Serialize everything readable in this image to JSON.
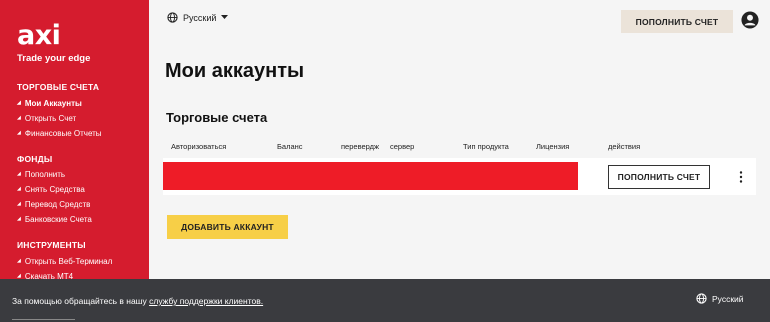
{
  "sidebar": {
    "logo": "axi",
    "tagline": "Trade your edge",
    "sections": [
      {
        "title": "ТОРГОВЫЕ СЧЕТА",
        "items": [
          "Мои Аккаунты",
          "Открыть Счет",
          "Финансовые Отчеты"
        ]
      },
      {
        "title": "ФОНДЫ",
        "items": [
          "Пополнить",
          "Снять Средства",
          "Перевод Средств",
          "Банковские Счета"
        ]
      },
      {
        "title": "ИНСТРУМЕНТЫ",
        "items": [
          "Открыть Веб-Терминал",
          "Скачать МТ4"
        ]
      }
    ]
  },
  "header": {
    "language": "Русский",
    "fund_button": "ПОПОЛНИТЬ СЧЕТ"
  },
  "main": {
    "title": "Мои аккаунты",
    "section_title": "Торговые счета",
    "columns": [
      "Авторизоваться",
      "Баланс",
      "перевердж",
      "сервер",
      "Тип продукта",
      "Лицензия",
      "действия"
    ],
    "row_fund_button": "ПОПОЛНИТЬ СЧЕТ",
    "add_account_button": "ДОБАВИТЬ АККАУНТ"
  },
  "footer": {
    "help_text": "За помощью обращайтесь в нашу ",
    "help_link": "службу поддержки клиентов.",
    "language": "Русский"
  },
  "colors": {
    "brand_red": "#d51c2e",
    "redaction": "#ee1c27",
    "accent_yellow": "#f7cf47",
    "beige_button": "#ebe3d9",
    "footer_bg": "#3a3b3f"
  }
}
